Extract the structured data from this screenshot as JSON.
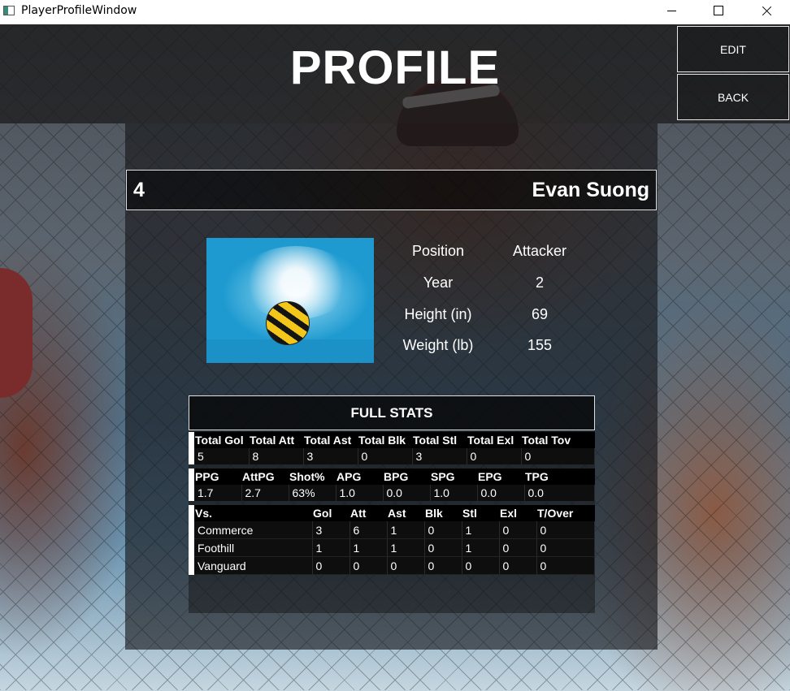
{
  "window": {
    "title": "PlayerProfileWindow"
  },
  "header": {
    "title": "PROFILE"
  },
  "buttons": {
    "edit": "EDIT",
    "back": "BACK"
  },
  "player": {
    "number": "4",
    "name": "Evan Suong",
    "details": [
      {
        "label": "Position",
        "value": "Attacker"
      },
      {
        "label": "Year",
        "value": "2"
      },
      {
        "label": "Height (in)",
        "value": "69"
      },
      {
        "label": "Weight (lb)",
        "value": "155"
      }
    ]
  },
  "stats": {
    "title": "FULL STATS",
    "totals": {
      "headers": [
        "Total Gol",
        "Total Att",
        "Total Ast",
        "Total Blk",
        "Total Stl",
        "Total Exl",
        "Total Tov"
      ],
      "values": [
        "5",
        "8",
        "3",
        "0",
        "3",
        "0",
        "0"
      ]
    },
    "averages": {
      "headers": [
        "PPG",
        "AttPG",
        "Shot%",
        "APG",
        "BPG",
        "SPG",
        "EPG",
        "TPG"
      ],
      "values": [
        "1.7",
        "2.7",
        "63%",
        "1.0",
        "0.0",
        "1.0",
        "0.0",
        "0.0"
      ]
    },
    "versus": {
      "headers": [
        "Vs.",
        "Gol",
        "Att",
        "Ast",
        "Blk",
        "Stl",
        "Exl",
        "T/Over"
      ],
      "rows": [
        [
          "Commerce",
          "3",
          "6",
          "1",
          "0",
          "1",
          "0",
          "0"
        ],
        [
          "Foothill",
          "1",
          "1",
          "1",
          "0",
          "1",
          "0",
          "0"
        ],
        [
          "Vanguard",
          "0",
          "0",
          "0",
          "0",
          "0",
          "0",
          "0"
        ]
      ]
    }
  }
}
